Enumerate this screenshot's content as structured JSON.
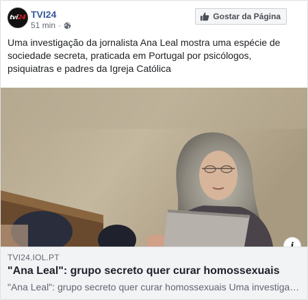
{
  "post": {
    "page_name": "TVI24",
    "avatar": {
      "text_part1": "tvi",
      "text_part2": "24"
    },
    "time": "51 min",
    "time_separator": "·",
    "privacy_icon": "globe-icon",
    "like_button_label": "Gostar da Página",
    "like_icon": "thumb-up-icon",
    "text": "Uma investigação da jornalista Ana Leal mostra uma espécie de sociedade secreta, praticada em Portugal por psicólogos, psiquiatras e padres da Igreja Católica"
  },
  "link_preview": {
    "domain": "TVI24.IOL.PT",
    "title": "\"Ana Leal\": grupo secreto quer curar homossexuais",
    "description": "\"Ana Leal\": grupo secreto quer curar homossexuais Uma investigação da jornalista Ana Leal mostra uma espécie de sociedade secreta",
    "info_icon": "info-icon"
  },
  "colors": {
    "link_blue": "#385898",
    "meta_gray": "#606770",
    "preview_bg": "#f2f3f5"
  }
}
